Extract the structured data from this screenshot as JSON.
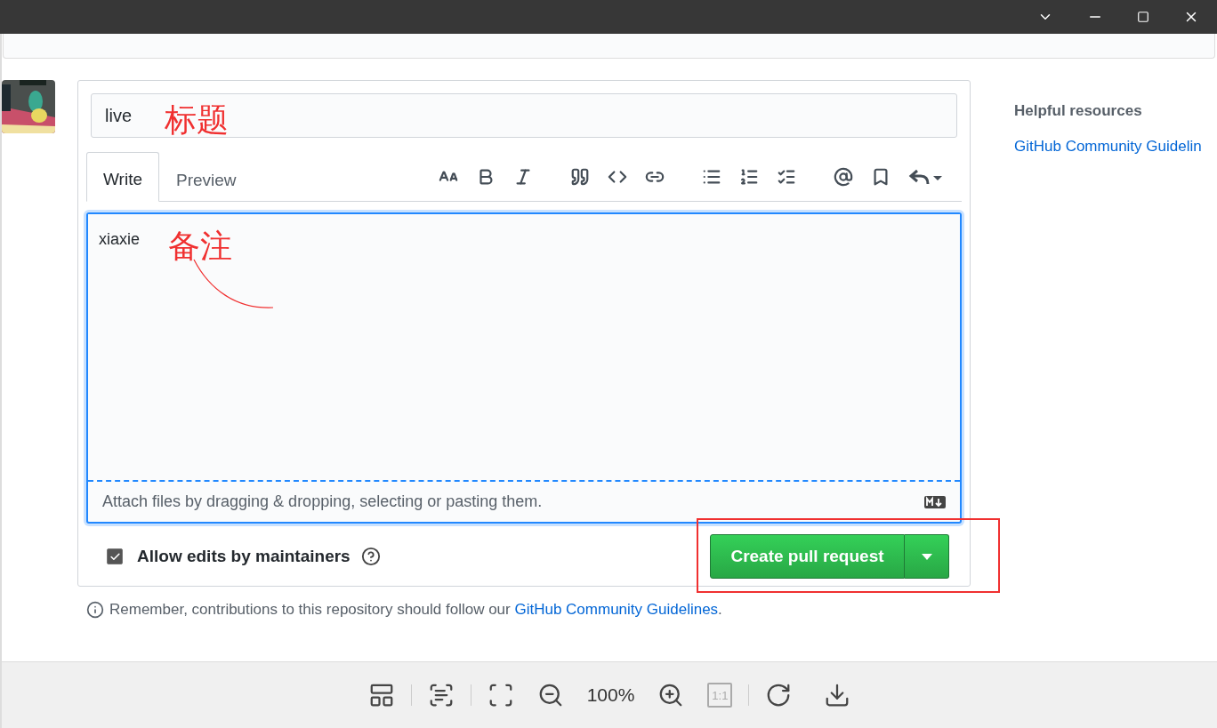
{
  "pull_request": {
    "title_field": {
      "value": "live"
    },
    "tabs": [
      {
        "label": "Write",
        "selected": true
      },
      {
        "label": "Preview",
        "selected": false
      }
    ],
    "body_field": {
      "value": "xiaxie",
      "footer": "Attach files by dragging & dropping, selecting or pasting them."
    },
    "allow_edits": {
      "label": "Allow edits by maintainers",
      "checked": true
    },
    "submit_button": {
      "label": "Create pull request"
    },
    "note": {
      "text": "Remember, contributions to this repository should follow our",
      "link": "GitHub Community Guidelines",
      "end": "."
    }
  },
  "sidebar": {
    "heading": "Helpful resources",
    "link": "GitHub Community Guidelin"
  },
  "annotations": [
    {
      "kind": "label",
      "text": "标题"
    },
    {
      "kind": "label",
      "text": "备注"
    },
    {
      "kind": "stroke"
    },
    {
      "kind": "frame"
    }
  ],
  "viewer_toolbar": {
    "zoom": "100%",
    "actual_size": {
      "label": "1:1",
      "disabled": true
    }
  }
}
